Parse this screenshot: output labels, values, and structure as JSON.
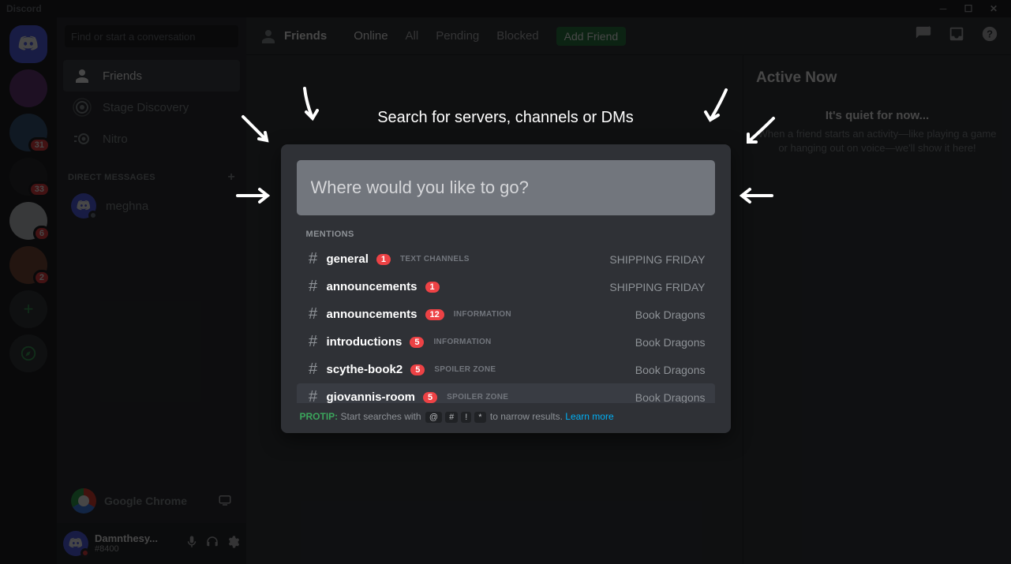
{
  "titlebar": {
    "app_name": "Discord"
  },
  "guilds": [
    {
      "type": "home"
    },
    {
      "badge": ""
    },
    {
      "badge": "31"
    },
    {
      "badge": "33"
    },
    {
      "badge": "6"
    },
    {
      "badge": "2"
    },
    {
      "type": "add"
    },
    {
      "type": "explore"
    }
  ],
  "sidebar": {
    "search_placeholder": "Find or start a conversation",
    "nav": [
      {
        "label": "Friends",
        "active": true
      },
      {
        "label": "Stage Discovery",
        "active": false
      },
      {
        "label": "Nitro",
        "active": false
      }
    ],
    "dm_header": "DIRECT MESSAGES",
    "dms": [
      {
        "name": "meghna"
      }
    ],
    "activity": {
      "app": "Google Chrome"
    },
    "user": {
      "name": "Damnthesy...",
      "discriminator": "#8400"
    }
  },
  "topbar": {
    "title": "Friends",
    "tabs": [
      "Online",
      "All",
      "Pending",
      "Blocked"
    ],
    "active_tab": "Online",
    "add_friend": "Add Friend"
  },
  "right": {
    "header": "Active Now",
    "quiet_title": "It's quiet for now...",
    "quiet_sub": "When a friend starts an activity—like playing a game or hanging out on voice—we'll show it here!"
  },
  "quickswitcher": {
    "title": "Search for servers, channels or DMs",
    "placeholder": "Where would you like to go?",
    "section": "MENTIONS",
    "rows": [
      {
        "name": "general",
        "badge": "1",
        "category": "TEXT CHANNELS",
        "server": "SHIPPING FRIDAY"
      },
      {
        "name": "announcements",
        "badge": "1",
        "category": "",
        "server": "SHIPPING FRIDAY"
      },
      {
        "name": "announcements",
        "badge": "12",
        "category": "INFORMATION",
        "server": "Book Dragons"
      },
      {
        "name": "introductions",
        "badge": "5",
        "category": "INFORMATION",
        "server": "Book Dragons"
      },
      {
        "name": "scythe-book2",
        "badge": "5",
        "category": "SPOILER ZONE",
        "server": "Book Dragons"
      },
      {
        "name": "giovannis-room",
        "badge": "5",
        "category": "SPOILER ZONE",
        "server": "Book Dragons"
      }
    ],
    "protip_label": "PROTIP:",
    "protip_text_a": "Start searches with",
    "protip_keys": [
      "@",
      "#",
      "!",
      "*"
    ],
    "protip_text_b": "to narrow results.",
    "protip_link": "Learn more"
  }
}
